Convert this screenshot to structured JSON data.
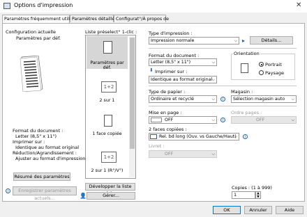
{
  "window": {
    "title": "Options d'impression"
  },
  "tabs": [
    {
      "label": "Paramètres fréquemment utilisés"
    },
    {
      "label": "Paramètres détaillés"
    },
    {
      "label": "Configurat°/À propos de"
    }
  ],
  "left": {
    "group_title": "Configuration actuelle",
    "subtitle": "Paramètres par déf.",
    "summary": [
      "Format du document :",
      "Letter (8,5\" x 11\")",
      "Imprimer sur :",
      "Identique au format original",
      "Réduction/Agrandissement :",
      "Ajuster au format d'impression"
    ],
    "summary_button": "Résumé des paramètres",
    "save_button": "Enregistrer paramètres actuels..."
  },
  "presets": {
    "title": "Liste préselect° 1-clic :",
    "items": [
      {
        "label": "Paramètres par déf.",
        "selected": true
      },
      {
        "label": "2 sur 1"
      },
      {
        "label": "1 face copiée"
      },
      {
        "label": "2 sur 1 (R°/V°)"
      }
    ],
    "expand_button": "Développer la liste >>",
    "manage_button": "Gérer..."
  },
  "right": {
    "print_type": {
      "label": "Type d'impression :",
      "value": "Impression normale",
      "details_button": "Détails..."
    },
    "doc_size": {
      "label": "Format du document :",
      "value": "Letter (8,5\" x 11\")"
    },
    "print_on": {
      "label": "Imprimer sur :",
      "value": "Identique au format original"
    },
    "orientation": {
      "label": "Orientation",
      "options": [
        "Portrait",
        "Paysage"
      ],
      "selected": "Portrait"
    },
    "paper_type": {
      "label": "Type de papier :",
      "value": "Ordinaire et recyclé"
    },
    "tray": {
      "label": "Magasin :",
      "value": "Sélection magasin auto"
    },
    "layout": {
      "label": "Mise en page :",
      "value": "OFF"
    },
    "page_order": {
      "label": "Ordre pages :",
      "value": "OFF"
    },
    "duplex": {
      "label": "2 faces copiées :",
      "value": "Rel. bd long (Ouv. vs Gauche/Haut)"
    },
    "booklet": {
      "label": "Livret :",
      "value": "OFF"
    },
    "copies": {
      "label": "Copies : (1 à 999)",
      "value": "1"
    }
  },
  "footer": {
    "ok": "OK",
    "cancel": "Annuler",
    "help": "Aide"
  },
  "colors": {
    "accent": "#0078d7",
    "info": "#1a63b8",
    "selected_bg": "#d6d6d6"
  }
}
